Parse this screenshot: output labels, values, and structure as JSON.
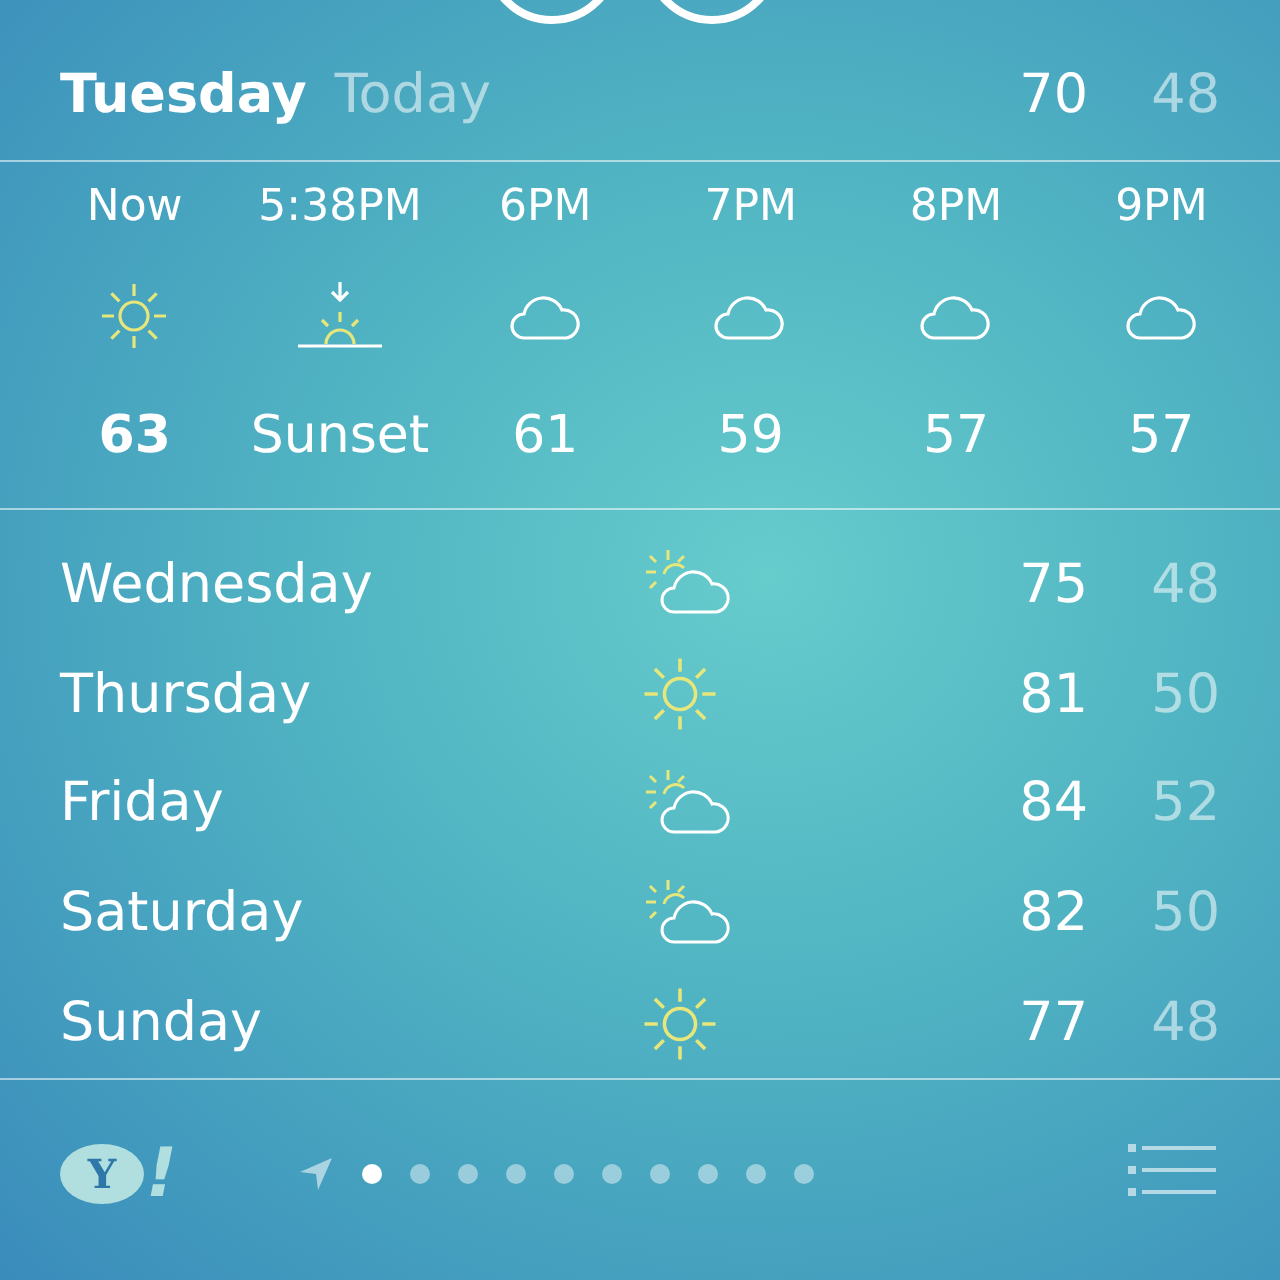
{
  "today": {
    "day": "Tuesday",
    "label": "Today",
    "high": "70",
    "low": "48"
  },
  "hourly": [
    {
      "time": "Now",
      "kind": "sun",
      "temp": "63",
      "current": true
    },
    {
      "time": "5:38PM",
      "kind": "sunset",
      "temp": "Sunset",
      "current": false
    },
    {
      "time": "6PM",
      "kind": "cloud",
      "temp": "61",
      "current": false
    },
    {
      "time": "7PM",
      "kind": "cloud",
      "temp": "59",
      "current": false
    },
    {
      "time": "8PM",
      "kind": "cloud",
      "temp": "57",
      "current": false
    },
    {
      "time": "9PM",
      "kind": "cloud",
      "temp": "57",
      "current": false
    }
  ],
  "daily": [
    {
      "day": "Wednesday",
      "kind": "partly",
      "high": "75",
      "low": "48"
    },
    {
      "day": "Thursday",
      "kind": "sun",
      "high": "81",
      "low": "50"
    },
    {
      "day": "Friday",
      "kind": "partly",
      "high": "84",
      "low": "52"
    },
    {
      "day": "Saturday",
      "kind": "partly",
      "high": "82",
      "low": "50"
    },
    {
      "day": "Sunday",
      "kind": "sun",
      "high": "77",
      "low": "48"
    }
  ],
  "footer": {
    "logo": {
      "letter": "Y",
      "mark": "!"
    },
    "pages": [
      {
        "kind": "location",
        "selected": false
      },
      {
        "kind": "dot",
        "selected": true
      },
      {
        "kind": "dot",
        "selected": false
      },
      {
        "kind": "dot",
        "selected": false
      },
      {
        "kind": "dot",
        "selected": false
      },
      {
        "kind": "dot",
        "selected": false
      },
      {
        "kind": "dot",
        "selected": false
      },
      {
        "kind": "dot",
        "selected": false
      },
      {
        "kind": "dot",
        "selected": false
      },
      {
        "kind": "dot",
        "selected": false
      },
      {
        "kind": "dot",
        "selected": false
      }
    ]
  }
}
